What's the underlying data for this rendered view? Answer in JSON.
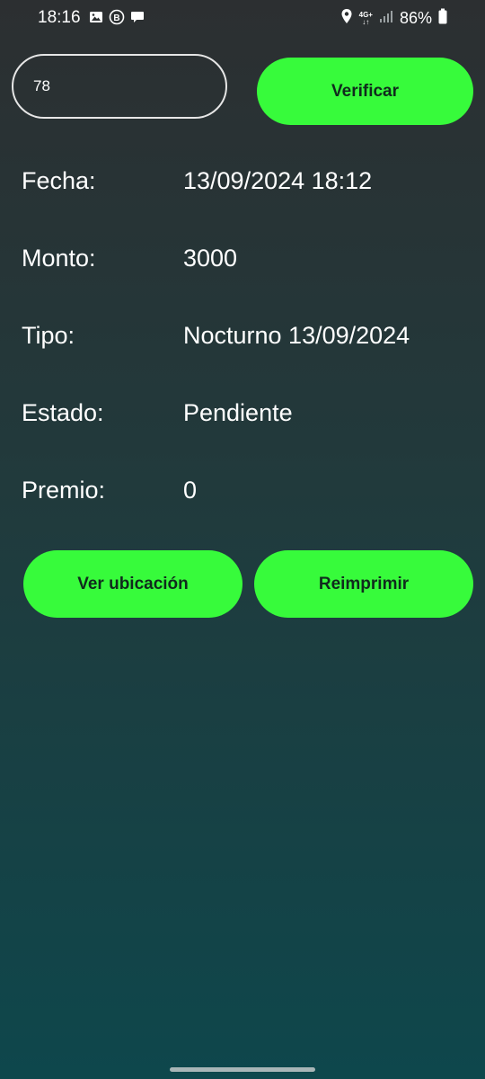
{
  "status_bar": {
    "time": "18:16",
    "battery": "86%",
    "network": "4G+",
    "icons": [
      "gallery-icon",
      "b-badge-icon",
      "chat-icon",
      "location-icon",
      "network-icon",
      "signal-icon",
      "battery-icon"
    ]
  },
  "search": {
    "value": "78",
    "button_label": "Verificar"
  },
  "details": [
    {
      "label": "Fecha:",
      "value": "13/09/2024 18:12"
    },
    {
      "label": "Monto:",
      "value": "3000"
    },
    {
      "label": "Tipo:",
      "value": "Nocturno 13/09/2024"
    },
    {
      "label": "Estado:",
      "value": "Pendiente"
    },
    {
      "label": "Premio:",
      "value": "0"
    }
  ],
  "actions": {
    "location_label": "Ver ubicación",
    "reprint_label": "Reimprimir"
  },
  "colors": {
    "accent": "#37fb3b",
    "button_text": "#102a1d",
    "background_top": "#2c2f31",
    "background_bottom": "#0e474c"
  }
}
